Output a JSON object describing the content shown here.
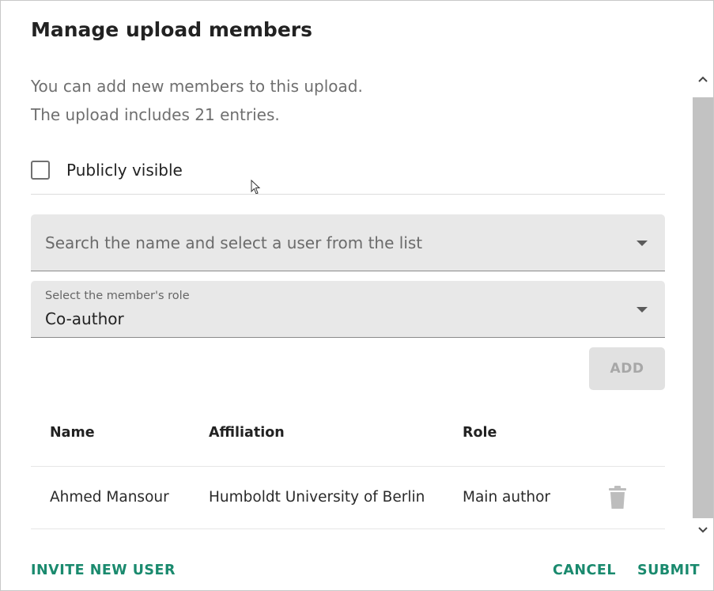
{
  "dialog": {
    "title": "Manage upload members",
    "description_line1": "You can add new members to this upload.",
    "description_line2": "The upload includes 21 entries."
  },
  "visibility": {
    "label": "Publicly visible",
    "checked": false
  },
  "search": {
    "placeholder": "Search the name and select a user from the list"
  },
  "role_select": {
    "label": "Select the member's role",
    "value": "Co-author"
  },
  "add_button": {
    "label": "ADD",
    "disabled": true
  },
  "members_table": {
    "headers": [
      "Name",
      "Affiliation",
      "Role"
    ],
    "rows": [
      {
        "name": "Ahmed Mansour",
        "affiliation": "Humboldt University of Berlin",
        "role": "Main author",
        "action_icon": "delete-icon"
      }
    ]
  },
  "footer": {
    "invite_label": "INVITE NEW USER",
    "cancel_label": "CANCEL",
    "submit_label": "SUBMIT"
  },
  "colors": {
    "accent": "#1a8a6e",
    "field_background": "#e8e8e8",
    "scrollbar": "#c2c2c2"
  }
}
